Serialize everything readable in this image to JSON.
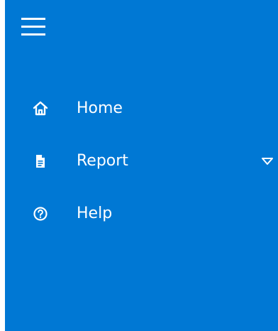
{
  "colors": {
    "sidebar_bg": "#0078d4",
    "foreground": "#ffffff"
  },
  "menu_button": {
    "icon": "hamburger-menu-icon"
  },
  "nav": {
    "items": [
      {
        "label": "Home",
        "icon": "home-icon",
        "has_submenu": false
      },
      {
        "label": "Report",
        "icon": "document-icon",
        "has_submenu": true
      },
      {
        "label": "Help",
        "icon": "help-circle-icon",
        "has_submenu": false
      }
    ]
  }
}
